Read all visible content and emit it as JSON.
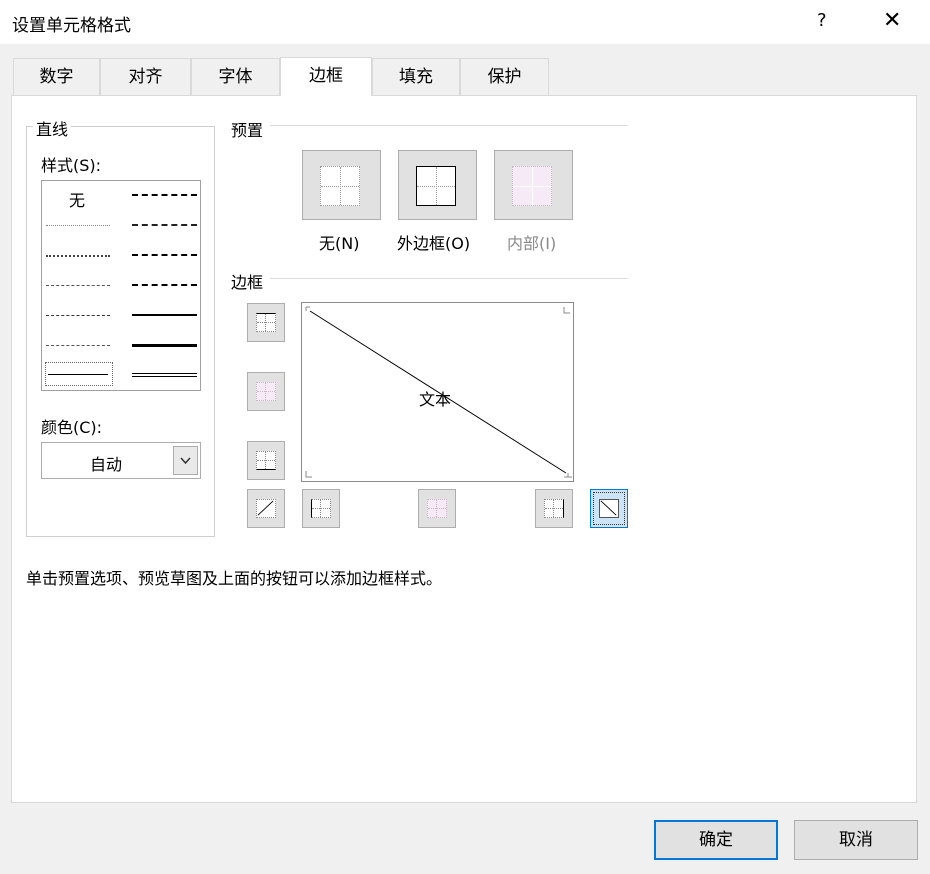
{
  "window": {
    "title": "设置单元格格式",
    "help_glyph": "?",
    "close_glyph": "✕"
  },
  "tabs": [
    {
      "label": "数字"
    },
    {
      "label": "对齐"
    },
    {
      "label": "字体"
    },
    {
      "label": "边框",
      "active": true
    },
    {
      "label": "填充"
    },
    {
      "label": "保护"
    }
  ],
  "line_group": {
    "title": "直线",
    "style_label": "样式(S):",
    "style_none": "无",
    "color_label": "颜色(C):",
    "color_value": "自动"
  },
  "presets": {
    "title": "预置",
    "none_label": "无(N)",
    "outline_label": "外边框(O)",
    "inside_label": "内部(I)"
  },
  "border": {
    "title": "边框",
    "preview_text": "文本"
  },
  "hint": "单击预置选项、预览草图及上面的按钮可以添加边框样式。",
  "buttons": {
    "ok": "确定",
    "cancel": "取消"
  },
  "colors": {
    "accent": "#0078d7",
    "disabled_text": "#8a8a8a",
    "inside_fill": "#f6eaf6"
  },
  "icons": [
    "help-icon",
    "close-icon",
    "chevron-down-icon",
    "diagonal-line-icon"
  ]
}
